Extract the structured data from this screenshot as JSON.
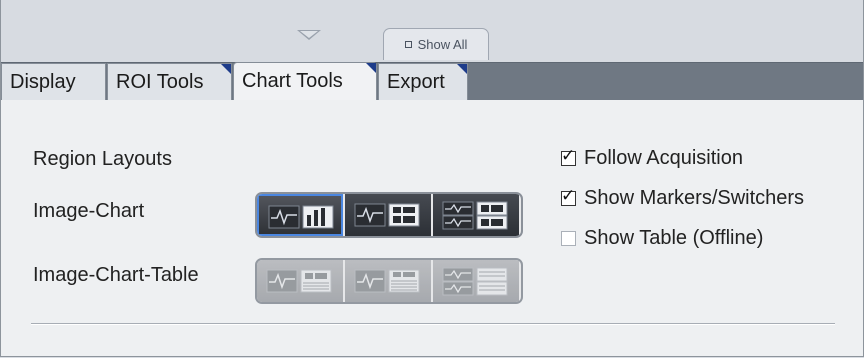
{
  "header": {
    "show_all_label": "Show All"
  },
  "tabs": [
    {
      "label": "Display",
      "active": false
    },
    {
      "label": "ROI Tools",
      "active": false
    },
    {
      "label": "Chart Tools",
      "active": true
    },
    {
      "label": "Export",
      "active": false
    }
  ],
  "panel": {
    "region_layouts_label": "Region Layouts",
    "rows": [
      {
        "label": "Image-Chart",
        "enabled": true,
        "selected_index": 0
      },
      {
        "label": "Image-Chart-Table",
        "enabled": false
      }
    ],
    "options": [
      {
        "label": "Follow Acquisition",
        "checked": true
      },
      {
        "label": "Show Markers/Switchers",
        "checked": true
      },
      {
        "label": "Show Table (Offline)",
        "checked": false
      }
    ]
  },
  "icons": {
    "layout_1": "image-bar-chart-icon",
    "layout_2": "image-chart-table-icon",
    "layout_3": "stacked-image-chart-icon"
  },
  "colors": {
    "accent": "#4a86e0",
    "tab_corner": "#1e3c8a",
    "tabbar": "#6f7883"
  }
}
